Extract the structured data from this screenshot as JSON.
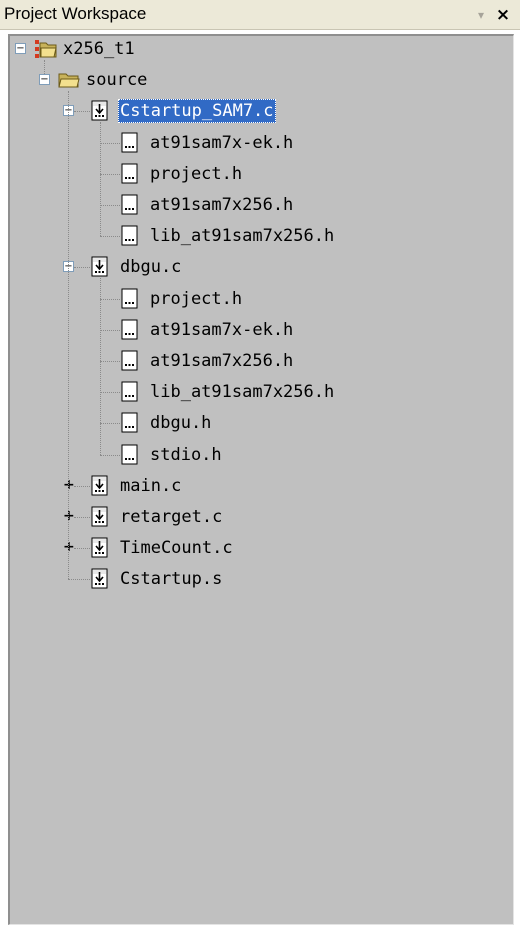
{
  "window": {
    "title": "Project Workspace",
    "dropdown_glyph": "▾",
    "close_glyph": "×"
  },
  "tree": {
    "root": {
      "label": "x256_t1",
      "icon": "project-icon",
      "expander": "−"
    },
    "folder": {
      "label": "source",
      "icon": "folder-open-icon",
      "expander": "−"
    },
    "files": [
      {
        "label": "Cstartup_SAM7.c",
        "icon": "source-file-icon",
        "expander": "−",
        "selected": true,
        "children": [
          "at91sam7x-ek.h",
          "project.h",
          "at91sam7x256.h",
          "lib_at91sam7x256.h"
        ]
      },
      {
        "label": "dbgu.c",
        "icon": "source-file-icon",
        "expander": "−",
        "selected": false,
        "children": [
          "project.h",
          "at91sam7x-ek.h",
          "at91sam7x256.h",
          "lib_at91sam7x256.h",
          "dbgu.h",
          "stdio.h"
        ]
      },
      {
        "label": "main.c",
        "icon": "source-file-icon",
        "expander": "+",
        "selected": false,
        "children": []
      },
      {
        "label": "retarget.c",
        "icon": "source-file-icon",
        "expander": "+",
        "selected": false,
        "children": []
      },
      {
        "label": "TimeCount.c",
        "icon": "source-file-icon",
        "expander": "+",
        "selected": false,
        "children": []
      },
      {
        "label": "Cstartup.s",
        "icon": "source-file-icon",
        "expander": "",
        "selected": false,
        "children": []
      }
    ],
    "header_icon": "header-file-icon",
    "selection_color": "#316ac5",
    "background_color": "#c0c0c0"
  }
}
